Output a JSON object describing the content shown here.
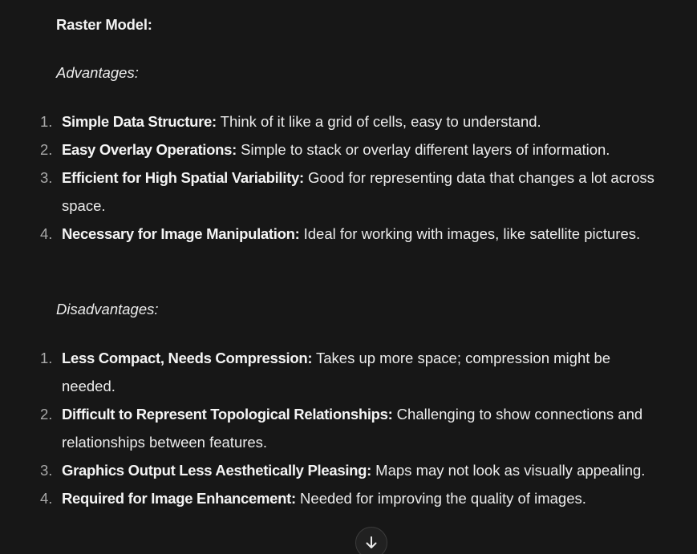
{
  "raster_model": {
    "heading": "Raster Model:",
    "advantages": {
      "label": "Advantages:",
      "items": [
        {
          "num": "1.",
          "term": "Simple Data Structure:",
          "desc": " Think of it like a grid of cells, easy to understand."
        },
        {
          "num": "2.",
          "term": "Easy Overlay Operations:",
          "desc": " Simple to stack or overlay different layers of information."
        },
        {
          "num": "3.",
          "term": "Efficient for High Spatial Variability:",
          "desc": " Good for representing data that changes a lot across space."
        },
        {
          "num": "4.",
          "term": "Necessary for Image Manipulation:",
          "desc": " Ideal for working with images, like satellite pictures."
        }
      ]
    },
    "disadvantages": {
      "label": "Disadvantages:",
      "items": [
        {
          "num": "1.",
          "term": "Less Compact, Needs Compression:",
          "desc": " Takes up more space; compression might be needed."
        },
        {
          "num": "2.",
          "term": "Difficult to Represent Topological Relationships:",
          "desc": " Challenging to show connections and relationships between features."
        },
        {
          "num": "3.",
          "term": "Graphics Output Less Aesthetically Pleasing:",
          "desc": " Maps may not look as visually appealing."
        },
        {
          "num": "4.",
          "term": "Required for Image Enhancement:",
          "desc": " Needed for improving the quality of images."
        }
      ]
    }
  },
  "scroll_button": {
    "icon": "arrow-down-icon"
  }
}
